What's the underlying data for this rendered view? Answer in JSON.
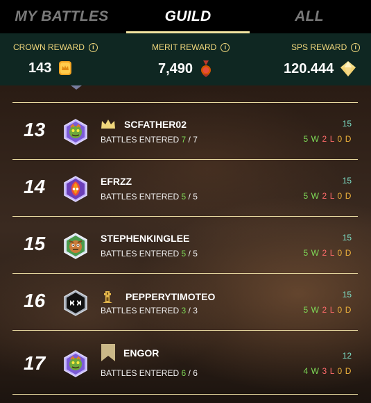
{
  "tabs": [
    {
      "label": "MY BATTLES"
    },
    {
      "label": "GUILD"
    },
    {
      "label": "ALL"
    }
  ],
  "active_tab": "GUILD",
  "rewards": {
    "crown": {
      "label": "CROWN REWARD",
      "value": "143",
      "icon": "crown-token-icon"
    },
    "merit": {
      "label": "MERIT REWARD",
      "value": "7,490",
      "icon": "merit-medal-icon"
    },
    "sps": {
      "label": "SPS REWARD",
      "value": "120.444",
      "icon": "sps-crystal-icon"
    }
  },
  "rows": [
    {
      "rank": "13",
      "name": "SCFATHER02",
      "badge": "crown-icon",
      "battles_label": "BATTLES ENTERED",
      "entered": "7",
      "total": "7",
      "score": "15",
      "w": "5",
      "l": "2",
      "d": "0",
      "avatar": "green-monster-avatar"
    },
    {
      "rank": "14",
      "name": "EFRZZ",
      "badge": "",
      "battles_label": "BATTLES ENTERED",
      "entered": "5",
      "total": "5",
      "score": "15",
      "w": "5",
      "l": "2",
      "d": "0",
      "avatar": "fire-skull-avatar"
    },
    {
      "rank": "15",
      "name": "STEPHENKINGLEE",
      "badge": "",
      "battles_label": "BATTLES ENTERED",
      "entered": "5",
      "total": "5",
      "score": "15",
      "w": "5",
      "l": "2",
      "d": "0",
      "avatar": "goblin-avatar"
    },
    {
      "rank": "16",
      "name": "PEPPERYTIMOTEO",
      "badge": "tower-icon",
      "battles_label": "BATTLES ENTERED",
      "entered": "3",
      "total": "3",
      "score": "15",
      "w": "5",
      "l": "2",
      "d": "0",
      "avatar": "black-monster-avatar"
    },
    {
      "rank": "17",
      "name": "ENGOR",
      "badge": "banner-icon",
      "battles_label": "BATTLES ENTERED",
      "entered": "6",
      "total": "6",
      "score": "12",
      "w": "4",
      "l": "3",
      "d": "0",
      "avatar": "green-monster-avatar"
    }
  ],
  "colors": {
    "accent": "#f0d77c",
    "win": "#7ed957",
    "loss": "#ff6b6b",
    "draw": "#f0b33c",
    "score": "#7ee0c8"
  }
}
